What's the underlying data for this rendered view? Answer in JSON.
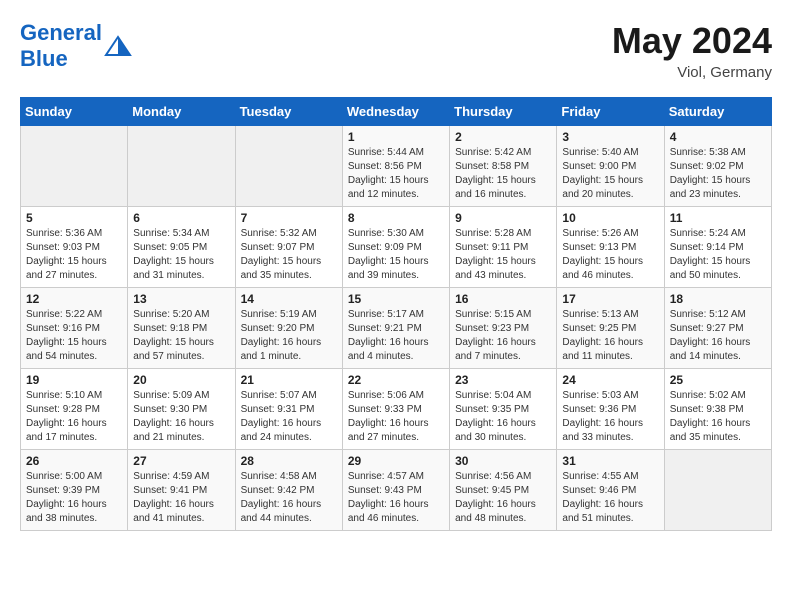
{
  "header": {
    "logo_general": "General",
    "logo_blue": "Blue",
    "month_year": "May 2024",
    "location": "Viol, Germany"
  },
  "days_of_week": [
    "Sunday",
    "Monday",
    "Tuesday",
    "Wednesday",
    "Thursday",
    "Friday",
    "Saturday"
  ],
  "weeks": [
    [
      {
        "day": "",
        "sunrise": "",
        "sunset": "",
        "daylight": "",
        "empty": true
      },
      {
        "day": "",
        "sunrise": "",
        "sunset": "",
        "daylight": "",
        "empty": true
      },
      {
        "day": "",
        "sunrise": "",
        "sunset": "",
        "daylight": "",
        "empty": true
      },
      {
        "day": "1",
        "sunrise": "Sunrise: 5:44 AM",
        "sunset": "Sunset: 8:56 PM",
        "daylight": "Daylight: 15 hours and 12 minutes."
      },
      {
        "day": "2",
        "sunrise": "Sunrise: 5:42 AM",
        "sunset": "Sunset: 8:58 PM",
        "daylight": "Daylight: 15 hours and 16 minutes."
      },
      {
        "day": "3",
        "sunrise": "Sunrise: 5:40 AM",
        "sunset": "Sunset: 9:00 PM",
        "daylight": "Daylight: 15 hours and 20 minutes."
      },
      {
        "day": "4",
        "sunrise": "Sunrise: 5:38 AM",
        "sunset": "Sunset: 9:02 PM",
        "daylight": "Daylight: 15 hours and 23 minutes."
      }
    ],
    [
      {
        "day": "5",
        "sunrise": "Sunrise: 5:36 AM",
        "sunset": "Sunset: 9:03 PM",
        "daylight": "Daylight: 15 hours and 27 minutes."
      },
      {
        "day": "6",
        "sunrise": "Sunrise: 5:34 AM",
        "sunset": "Sunset: 9:05 PM",
        "daylight": "Daylight: 15 hours and 31 minutes."
      },
      {
        "day": "7",
        "sunrise": "Sunrise: 5:32 AM",
        "sunset": "Sunset: 9:07 PM",
        "daylight": "Daylight: 15 hours and 35 minutes."
      },
      {
        "day": "8",
        "sunrise": "Sunrise: 5:30 AM",
        "sunset": "Sunset: 9:09 PM",
        "daylight": "Daylight: 15 hours and 39 minutes."
      },
      {
        "day": "9",
        "sunrise": "Sunrise: 5:28 AM",
        "sunset": "Sunset: 9:11 PM",
        "daylight": "Daylight: 15 hours and 43 minutes."
      },
      {
        "day": "10",
        "sunrise": "Sunrise: 5:26 AM",
        "sunset": "Sunset: 9:13 PM",
        "daylight": "Daylight: 15 hours and 46 minutes."
      },
      {
        "day": "11",
        "sunrise": "Sunrise: 5:24 AM",
        "sunset": "Sunset: 9:14 PM",
        "daylight": "Daylight: 15 hours and 50 minutes."
      }
    ],
    [
      {
        "day": "12",
        "sunrise": "Sunrise: 5:22 AM",
        "sunset": "Sunset: 9:16 PM",
        "daylight": "Daylight: 15 hours and 54 minutes."
      },
      {
        "day": "13",
        "sunrise": "Sunrise: 5:20 AM",
        "sunset": "Sunset: 9:18 PM",
        "daylight": "Daylight: 15 hours and 57 minutes."
      },
      {
        "day": "14",
        "sunrise": "Sunrise: 5:19 AM",
        "sunset": "Sunset: 9:20 PM",
        "daylight": "Daylight: 16 hours and 1 minute."
      },
      {
        "day": "15",
        "sunrise": "Sunrise: 5:17 AM",
        "sunset": "Sunset: 9:21 PM",
        "daylight": "Daylight: 16 hours and 4 minutes."
      },
      {
        "day": "16",
        "sunrise": "Sunrise: 5:15 AM",
        "sunset": "Sunset: 9:23 PM",
        "daylight": "Daylight: 16 hours and 7 minutes."
      },
      {
        "day": "17",
        "sunrise": "Sunrise: 5:13 AM",
        "sunset": "Sunset: 9:25 PM",
        "daylight": "Daylight: 16 hours and 11 minutes."
      },
      {
        "day": "18",
        "sunrise": "Sunrise: 5:12 AM",
        "sunset": "Sunset: 9:27 PM",
        "daylight": "Daylight: 16 hours and 14 minutes."
      }
    ],
    [
      {
        "day": "19",
        "sunrise": "Sunrise: 5:10 AM",
        "sunset": "Sunset: 9:28 PM",
        "daylight": "Daylight: 16 hours and 17 minutes."
      },
      {
        "day": "20",
        "sunrise": "Sunrise: 5:09 AM",
        "sunset": "Sunset: 9:30 PM",
        "daylight": "Daylight: 16 hours and 21 minutes."
      },
      {
        "day": "21",
        "sunrise": "Sunrise: 5:07 AM",
        "sunset": "Sunset: 9:31 PM",
        "daylight": "Daylight: 16 hours and 24 minutes."
      },
      {
        "day": "22",
        "sunrise": "Sunrise: 5:06 AM",
        "sunset": "Sunset: 9:33 PM",
        "daylight": "Daylight: 16 hours and 27 minutes."
      },
      {
        "day": "23",
        "sunrise": "Sunrise: 5:04 AM",
        "sunset": "Sunset: 9:35 PM",
        "daylight": "Daylight: 16 hours and 30 minutes."
      },
      {
        "day": "24",
        "sunrise": "Sunrise: 5:03 AM",
        "sunset": "Sunset: 9:36 PM",
        "daylight": "Daylight: 16 hours and 33 minutes."
      },
      {
        "day": "25",
        "sunrise": "Sunrise: 5:02 AM",
        "sunset": "Sunset: 9:38 PM",
        "daylight": "Daylight: 16 hours and 35 minutes."
      }
    ],
    [
      {
        "day": "26",
        "sunrise": "Sunrise: 5:00 AM",
        "sunset": "Sunset: 9:39 PM",
        "daylight": "Daylight: 16 hours and 38 minutes."
      },
      {
        "day": "27",
        "sunrise": "Sunrise: 4:59 AM",
        "sunset": "Sunset: 9:41 PM",
        "daylight": "Daylight: 16 hours and 41 minutes."
      },
      {
        "day": "28",
        "sunrise": "Sunrise: 4:58 AM",
        "sunset": "Sunset: 9:42 PM",
        "daylight": "Daylight: 16 hours and 44 minutes."
      },
      {
        "day": "29",
        "sunrise": "Sunrise: 4:57 AM",
        "sunset": "Sunset: 9:43 PM",
        "daylight": "Daylight: 16 hours and 46 minutes."
      },
      {
        "day": "30",
        "sunrise": "Sunrise: 4:56 AM",
        "sunset": "Sunset: 9:45 PM",
        "daylight": "Daylight: 16 hours and 48 minutes."
      },
      {
        "day": "31",
        "sunrise": "Sunrise: 4:55 AM",
        "sunset": "Sunset: 9:46 PM",
        "daylight": "Daylight: 16 hours and 51 minutes."
      },
      {
        "day": "",
        "sunrise": "",
        "sunset": "",
        "daylight": "",
        "empty": true
      }
    ]
  ]
}
